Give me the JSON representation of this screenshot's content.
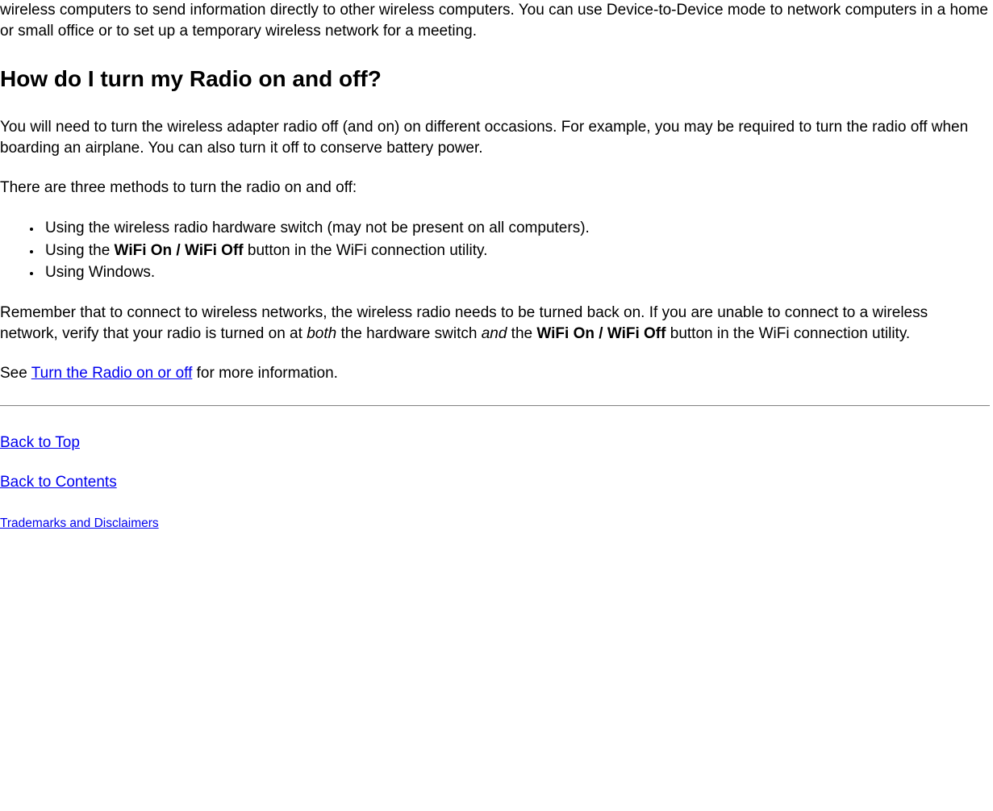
{
  "intro_paragraph": "wireless computers to send information directly to other wireless computers. You can use Device-to-Device mode to network computers in a home or small office or to set up a temporary wireless network for a meeting.",
  "heading": "How do I turn my Radio on and off?",
  "para1": "You will need to turn the wireless adapter radio off (and on) on different occasions. For example, you may be required to turn the radio off when boarding an airplane. You can also turn it off to conserve battery power.",
  "para2": "There are three methods to turn the radio on and off:",
  "bullets": {
    "item1": "Using the wireless radio hardware switch (may not be present on all computers).",
    "item2_prefix": "Using the ",
    "item2_bold": "WiFi On / WiFi Off",
    "item2_suffix": " button in the WiFi connection utility.",
    "item3": "Using Windows."
  },
  "para3": {
    "part1": "Remember that to connect to wireless networks, the wireless radio needs to be turned back on. If you are unable to connect to a wireless network, verify that your radio is turned on at ",
    "italic1": "both",
    "part2": " the hardware switch ",
    "italic2": "and",
    "part3": " the ",
    "bold": "WiFi On / WiFi Off",
    "part4": " button in the WiFi connection utility."
  },
  "para4": {
    "prefix": "See ",
    "link": "Turn the Radio on or off",
    "suffix": " for more information."
  },
  "links": {
    "back_to_top": "Back to Top",
    "back_to_contents": "Back to Contents",
    "trademarks": "Trademarks and Disclaimers"
  }
}
